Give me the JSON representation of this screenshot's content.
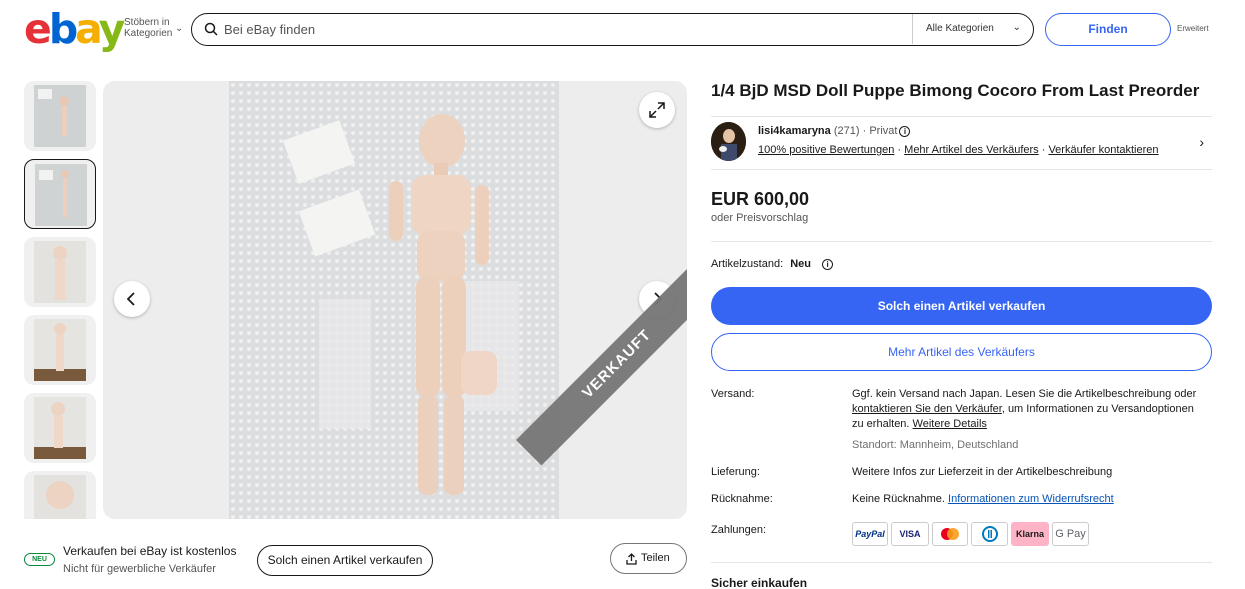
{
  "header": {
    "logo_letters": [
      "e",
      "b",
      "a",
      "y"
    ],
    "browse_label": "Stöbern in Kategorien",
    "search_placeholder": "Bei eBay finden",
    "category_select": "Alle Kategorien",
    "find_button": "Finden",
    "advanced_link": "Erweitert"
  },
  "gallery": {
    "thumbnail_count": 6,
    "selected_index": 1,
    "sold_banner": "VERKAUFT"
  },
  "below_image": {
    "badge": "NEU",
    "sell_title": "Verkaufen bei eBay ist kostenlos",
    "sell_subtitle": "Nicht für gewerbliche Verkäufer",
    "sell_button": "Solch einen Artikel verkaufen",
    "share_button": "Teilen"
  },
  "listing": {
    "title": "1/4 BjD MSD Doll Puppe Bimong Cocoro From Last Preorder",
    "seller": {
      "name": "lisi4kamaryna",
      "rating_count": "(271)",
      "type": "Privat",
      "positive": "100% positive Bewertungen",
      "more_items": "Mehr Artikel des Verkäufers",
      "contact": "Verkäufer kontaktieren"
    },
    "price": "EUR 600,00",
    "offer_text": "oder Preisvorschlag",
    "condition_label": "Artikelzustand:",
    "condition_value": "Neu",
    "primary_button": "Solch einen Artikel verkaufen",
    "secondary_button": "Mehr Artikel des Verkäufers"
  },
  "details": {
    "shipping_label": "Versand:",
    "shipping_text_1": "Ggf. kein Versand nach Japan. Lesen Sie die Artikelbeschreibung oder",
    "shipping_link": "kontaktieren Sie den Verkäufer",
    "shipping_text_2": ", um Informationen zu Versandoptionen",
    "shipping_text_3": "zu erhalten.",
    "shipping_details_link": "Weitere Details",
    "location": "Standort: Mannheim, Deutschland",
    "delivery_label": "Lieferung:",
    "delivery_value": "Weitere Infos zur Lieferzeit in der Artikelbeschreibung",
    "returns_label": "Rücknahme:",
    "returns_value": "Keine Rücknahme.",
    "returns_link": "Informationen zum Widerrufsrecht",
    "payment_label": "Zahlungen:",
    "payments": [
      "PayPal",
      "VISA",
      "Mastercard",
      "Diners",
      "Klarna",
      "G Pay"
    ],
    "safe_shopping": "Sicher einkaufen"
  },
  "colors": {
    "ebay_red": "#e53238",
    "ebay_blue": "#0064d2",
    "ebay_yellow": "#f5af02",
    "ebay_green": "#86b817",
    "primary": "#3665f3"
  }
}
